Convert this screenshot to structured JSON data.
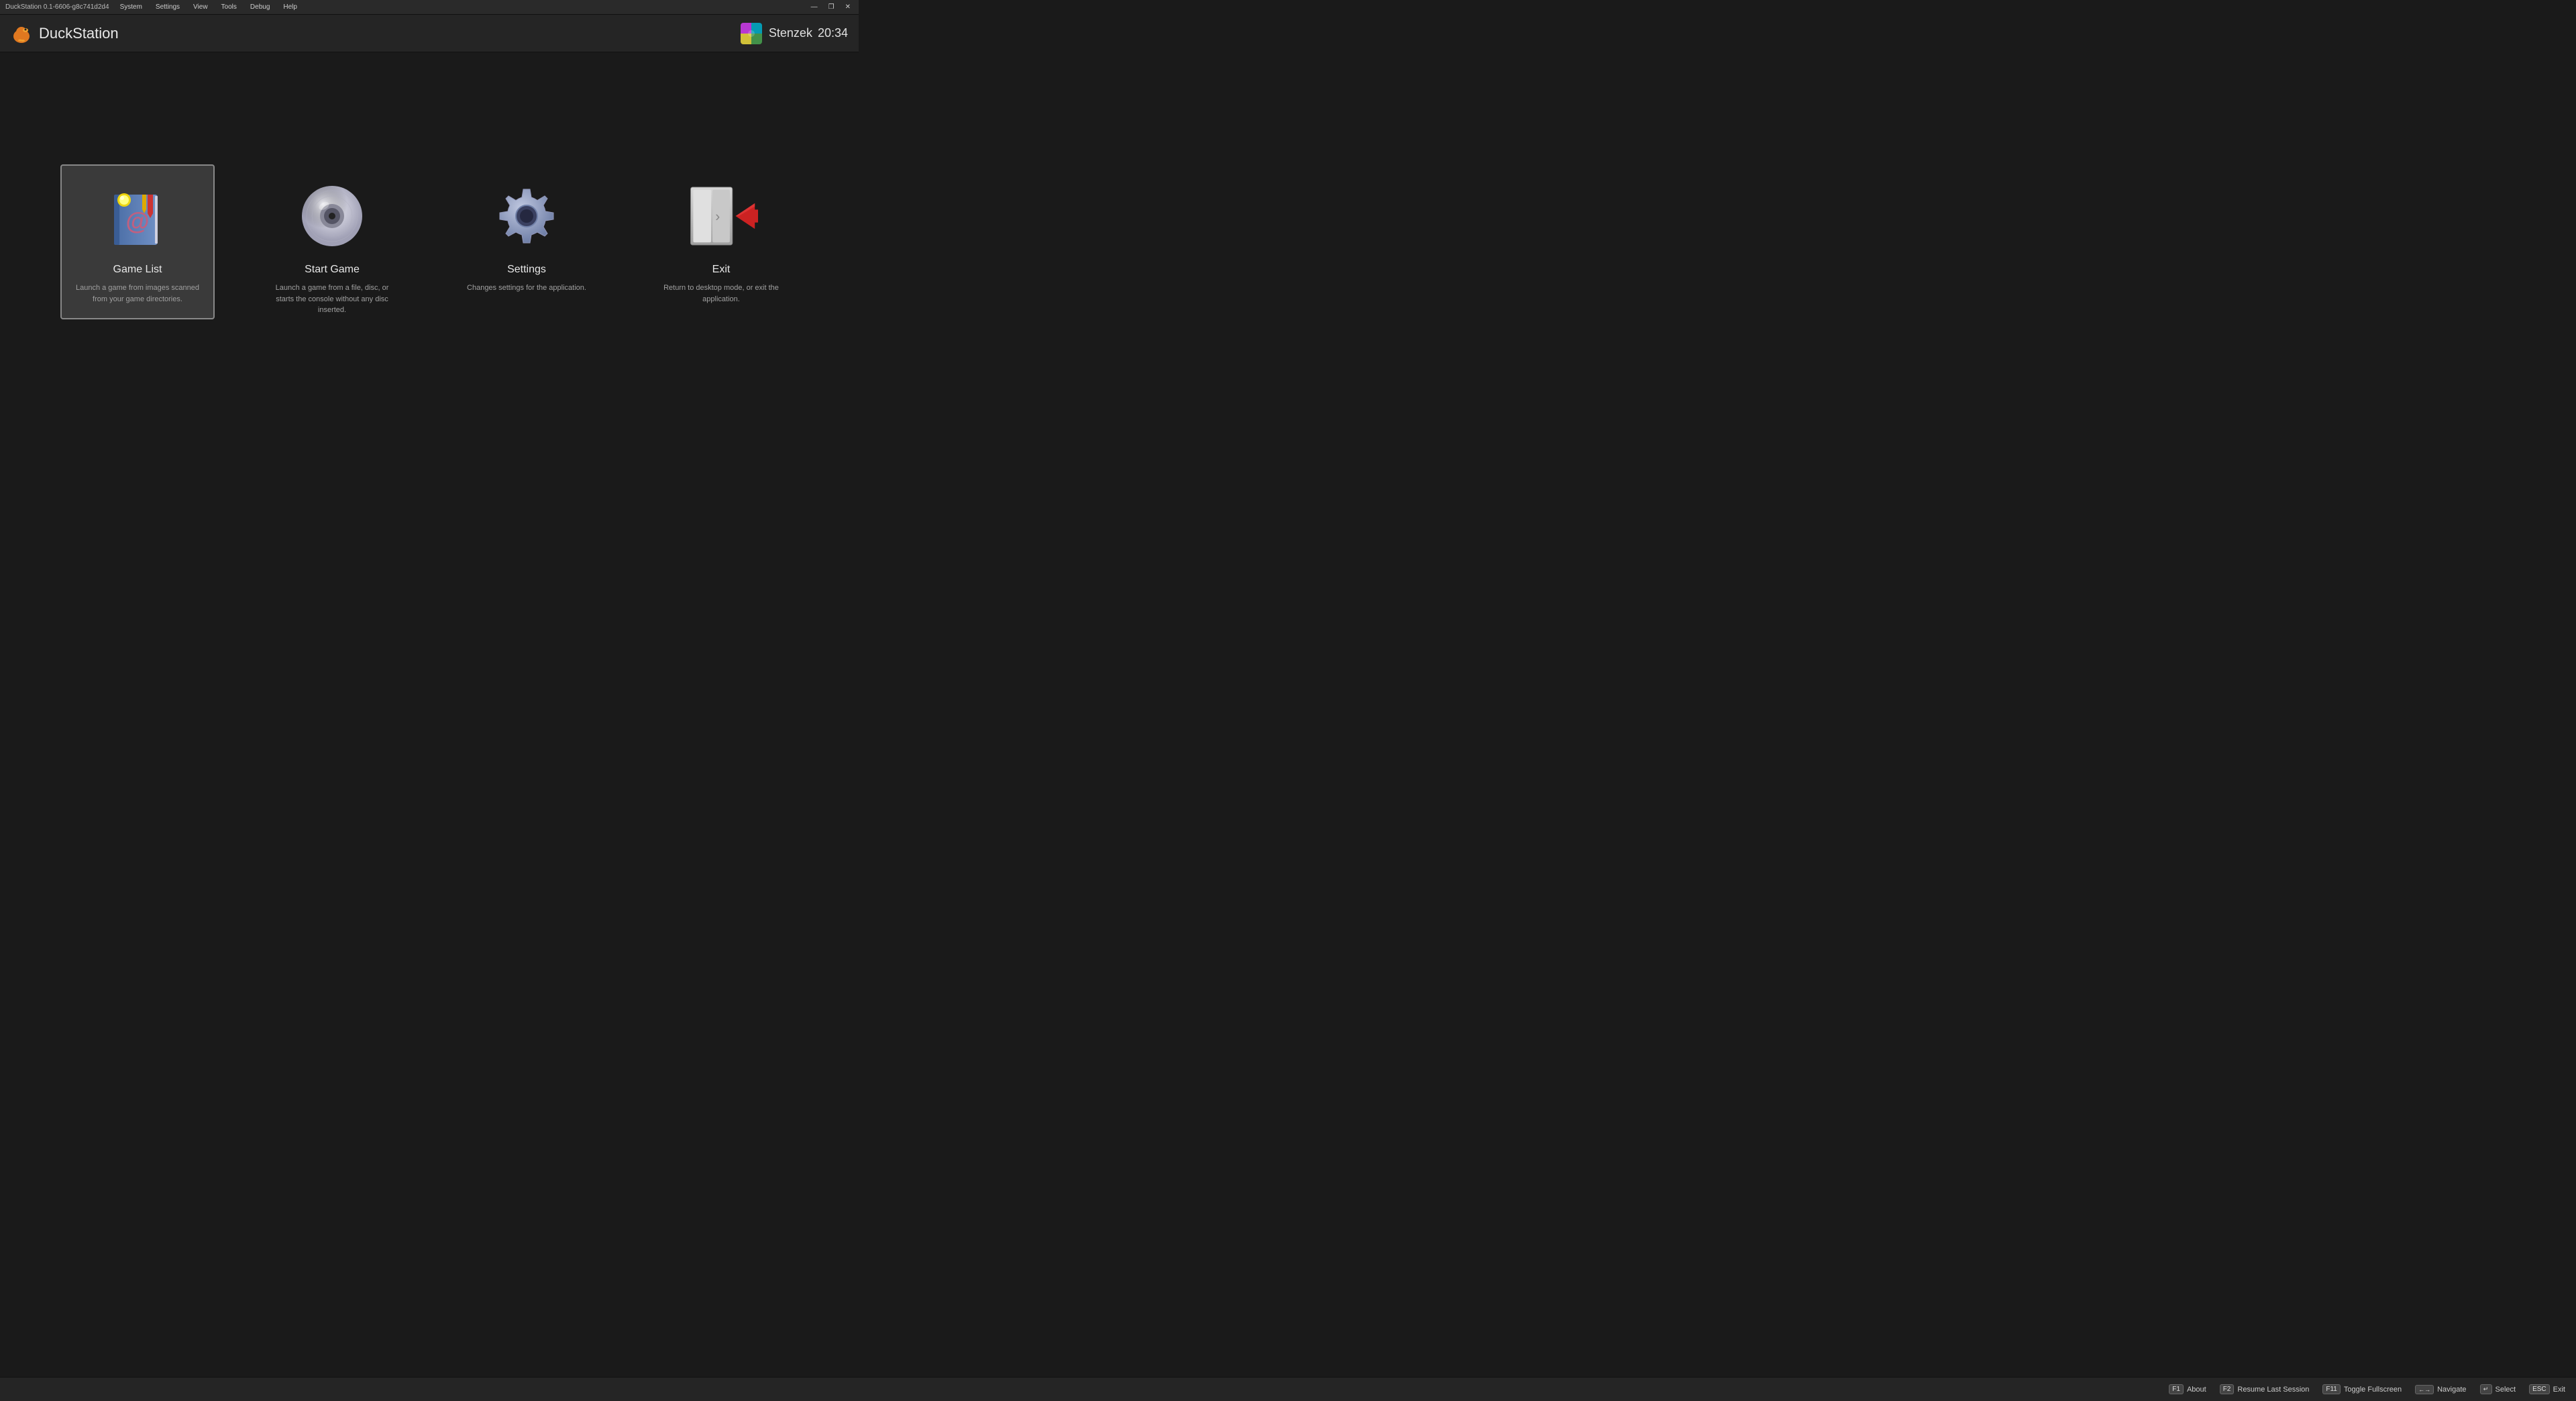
{
  "window": {
    "title": "DuckStation 0.1-6606-g8c741d2d4",
    "menus": [
      "System",
      "Settings",
      "View",
      "Tools",
      "Debug",
      "Help"
    ],
    "controls": [
      "—",
      "❐",
      "✕"
    ]
  },
  "header": {
    "app_name": "DuckStation",
    "user_name": "Stenzek",
    "time": "20:34"
  },
  "cards": [
    {
      "id": "game-list",
      "title": "Game List",
      "description": "Launch a game from images scanned from your game directories.",
      "selected": true
    },
    {
      "id": "start-game",
      "title": "Start Game",
      "description": "Launch a game from a file, disc, or starts the console without any disc inserted.",
      "selected": false
    },
    {
      "id": "settings",
      "title": "Settings",
      "description": "Changes settings for the application.",
      "selected": false
    },
    {
      "id": "exit",
      "title": "Exit",
      "description": "Return to desktop mode, or exit the application.",
      "selected": false
    }
  ],
  "bottom_bar": {
    "buttons": [
      {
        "key": "F1",
        "label": "About"
      },
      {
        "key": "F2",
        "label": "Resume Last Session"
      },
      {
        "key": "F11",
        "label": "Toggle Fullscreen"
      },
      {
        "key": "←→",
        "label": "Navigate"
      },
      {
        "key": "↵",
        "label": "Select"
      },
      {
        "key": "ESC",
        "label": "Exit"
      }
    ]
  }
}
